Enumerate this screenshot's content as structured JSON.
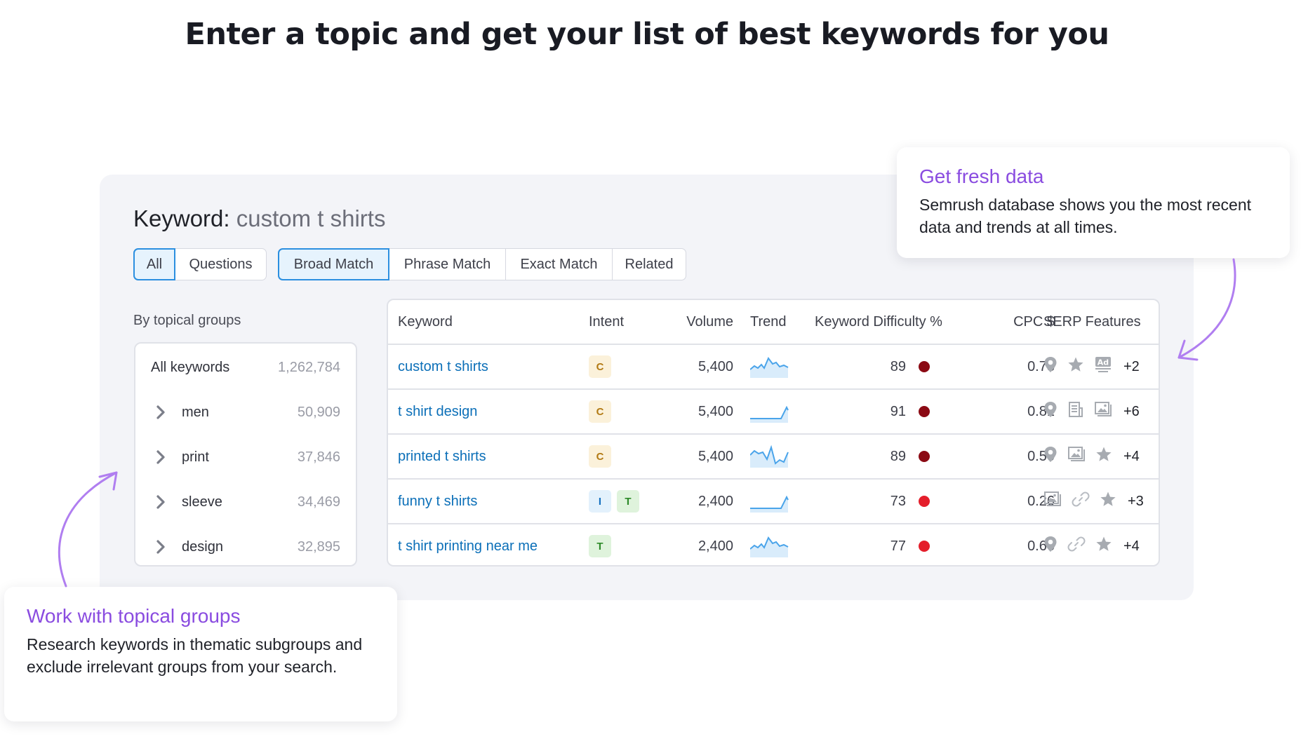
{
  "hero": {
    "title": "Enter a topic and get your list of best keywords for you"
  },
  "keyword": {
    "label": "Keyword:",
    "value": "custom t shirts"
  },
  "filters": {
    "scope_tabs": [
      {
        "label": "All",
        "active": true
      },
      {
        "label": "Questions",
        "active": false
      }
    ],
    "match_tabs": [
      {
        "label": "Broad Match",
        "active": true
      },
      {
        "label": "Phrase Match",
        "active": false
      },
      {
        "label": "Exact Match",
        "active": false
      },
      {
        "label": "Related",
        "active": false
      }
    ]
  },
  "groups": {
    "label": "By topical groups",
    "all": {
      "name": "All keywords",
      "count": "1,262,784"
    },
    "items": [
      {
        "name": "men",
        "count": "50,909"
      },
      {
        "name": "print",
        "count": "37,846"
      },
      {
        "name": "sleeve",
        "count": "34,469"
      },
      {
        "name": "design",
        "count": "32,895"
      }
    ]
  },
  "table": {
    "headers": {
      "keyword": "Keyword",
      "intent": "Intent",
      "volume": "Volume",
      "trend": "Trend",
      "kd": "Keyword Difficulty %",
      "cpc": "CPC $",
      "serp": "SERP Features"
    },
    "rows": [
      {
        "keyword": "custom t shirts",
        "intent": [
          "C"
        ],
        "volume": "5,400",
        "trend": "wavy",
        "kd": "89",
        "kd_color": "#8b0a14",
        "cpc": "0.73",
        "serp": [
          "pin-icon",
          "star-icon",
          "ad-icon"
        ],
        "serp_more": "+2"
      },
      {
        "keyword": "t shirt design",
        "intent": [
          "C"
        ],
        "volume": "5,400",
        "trend": "spike",
        "kd": "91",
        "kd_color": "#8b0a14",
        "cpc": "0.81",
        "serp": [
          "pin-icon",
          "news-icon",
          "image-icon"
        ],
        "serp_more": "+6"
      },
      {
        "keyword": "printed t shirts",
        "intent": [
          "C"
        ],
        "volume": "5,400",
        "trend": "zigzag",
        "kd": "89",
        "kd_color": "#8b0a14",
        "cpc": "0.50",
        "serp": [
          "pin-icon",
          "image-icon",
          "star-icon"
        ],
        "serp_more": "+4"
      },
      {
        "keyword": "funny t shirts",
        "intent": [
          "I",
          "T"
        ],
        "volume": "2,400",
        "trend": "spike",
        "kd": "73",
        "kd_color": "#e41e2b",
        "cpc": "0.26",
        "serp": [
          "image-icon",
          "link-icon",
          "star-icon"
        ],
        "serp_more": "+3"
      },
      {
        "keyword": "t shirt printing near me",
        "intent": [
          "T"
        ],
        "volume": "2,400",
        "trend": "wavy",
        "kd": "77",
        "kd_color": "#e41e2b",
        "cpc": "0.66",
        "serp": [
          "pin-icon",
          "link-icon",
          "star-icon"
        ],
        "serp_more": "+4"
      }
    ]
  },
  "callouts": {
    "fresh": {
      "title": "Get fresh data",
      "text": "Semrush database shows you the most recent data and trends at all times."
    },
    "groups": {
      "title": "Work with topical groups",
      "text": "Research keywords in thematic subgroups and exclude irrelevant groups from your search."
    }
  },
  "colors": {
    "accent_purple": "#8a4ce0",
    "link_blue": "#0b6fb8",
    "active_tab_border": "#2b8fe0",
    "panel_bg": "#f3f4f8"
  }
}
